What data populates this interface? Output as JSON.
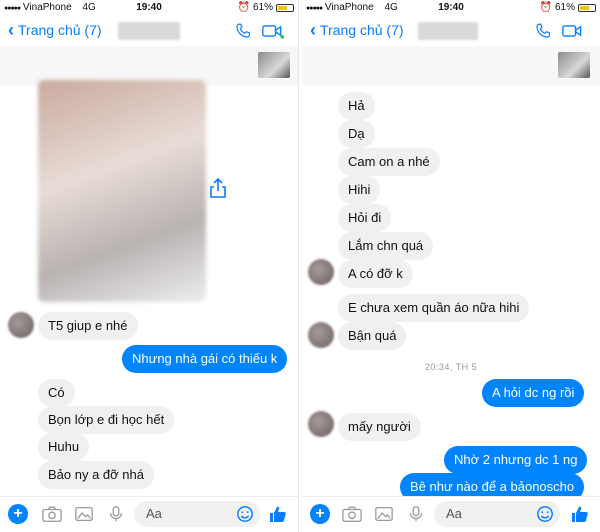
{
  "left": {
    "status": {
      "carrier": "VinaPhone",
      "network": "4G",
      "time": "19:40",
      "battery": "61%"
    },
    "nav": {
      "back_label": "Trang chủ (7)"
    },
    "messages": [
      {
        "text": "T5 giup e nhé",
        "dir": "in"
      },
      {
        "text": "Nhưng nhà gái có thiếu k",
        "dir": "out"
      },
      {
        "text": "Có",
        "dir": "in"
      },
      {
        "text": "Bọn lớp e đi học hết",
        "dir": "in"
      },
      {
        "text": "Huhu",
        "dir": "in"
      },
      {
        "text": "Bảo ny a đỡ nhá",
        "dir": "in"
      }
    ],
    "input": {
      "placeholder": "Aa"
    }
  },
  "right": {
    "status": {
      "carrier": "VinaPhone",
      "network": "4G",
      "time": "19:40",
      "battery": "61%"
    },
    "nav": {
      "back_label": "Trang chủ (7)"
    },
    "messages": [
      {
        "text": "Hả",
        "dir": "in"
      },
      {
        "text": "Dạ",
        "dir": "in"
      },
      {
        "text": "Cam on a nhé",
        "dir": "in"
      },
      {
        "text": "Hihi",
        "dir": "in"
      },
      {
        "text": "Hỏi đi",
        "dir": "in"
      },
      {
        "text": "Lắm chn quá",
        "dir": "in"
      },
      {
        "text": "A có đỡ k",
        "dir": "in"
      },
      {
        "text": "E chưa xem quần áo nữa hihi",
        "dir": "in"
      },
      {
        "text": "Bận quá",
        "dir": "in"
      },
      {
        "text": "A hỏi dc ng rồi",
        "dir": "out"
      },
      {
        "text": "mấy người",
        "dir": "in"
      },
      {
        "text": "Nhờ 2 nhưng dc 1 ng",
        "dir": "out"
      },
      {
        "text": "Bê như nào để a bảonoscho",
        "dir": "out"
      }
    ],
    "timestamp": "20:34, TH 5",
    "input": {
      "placeholder": "Aa"
    }
  },
  "colors": {
    "accent": "#0084ff",
    "nav_blue": "#0a7cff",
    "incoming": "#f0f0f0",
    "online_dot": "#31c24d"
  },
  "icons": [
    "chevron-left-icon",
    "phone-icon",
    "video-icon",
    "share-icon",
    "plus-icon",
    "camera-icon",
    "gallery-icon",
    "mic-icon",
    "smile-icon",
    "thumbs-up-icon"
  ]
}
